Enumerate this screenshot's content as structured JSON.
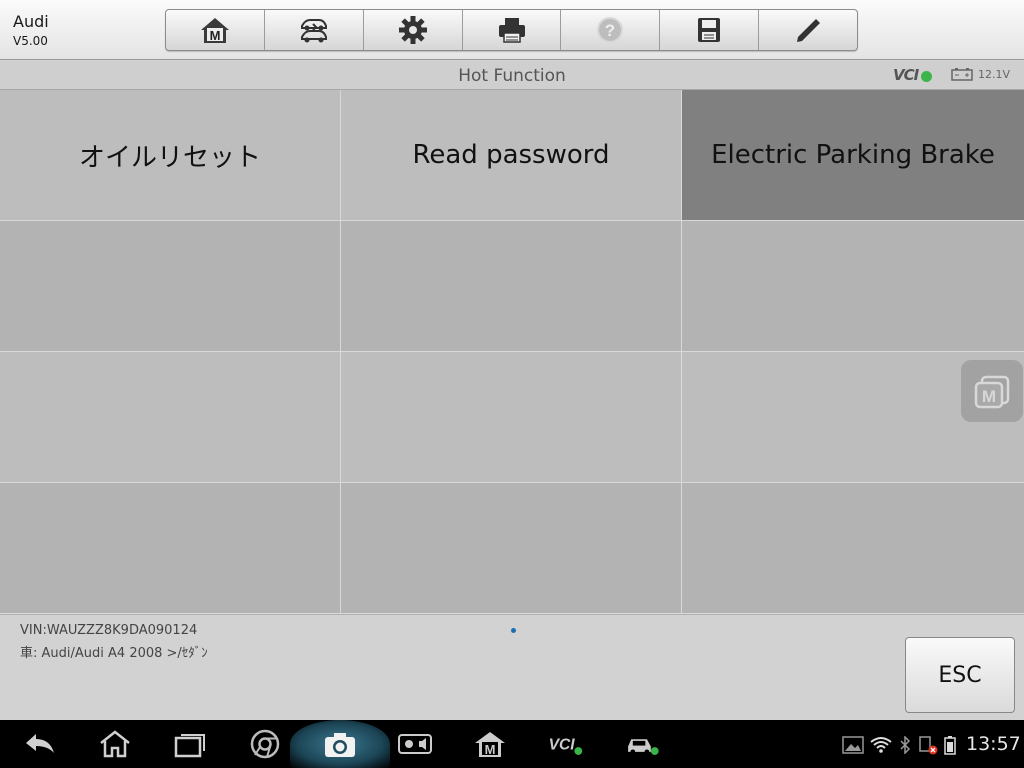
{
  "header": {
    "brand": "Audi",
    "version": "V5.00",
    "toolbar": [
      {
        "name": "home-icon",
        "label": "M"
      },
      {
        "name": "vehicle-swap-icon",
        "label": ""
      },
      {
        "name": "settings-gear-icon",
        "label": ""
      },
      {
        "name": "printer-icon",
        "label": ""
      },
      {
        "name": "help-icon",
        "label": ""
      },
      {
        "name": "save-icon",
        "label": ""
      },
      {
        "name": "edit-pencil-icon",
        "label": ""
      }
    ]
  },
  "subbar": {
    "title": "Hot Function",
    "vci": "VCI",
    "battery_voltage": "12.1V"
  },
  "functions": [
    {
      "label": "オイルリセット",
      "state": "normal"
    },
    {
      "label": "Read password",
      "state": "normal"
    },
    {
      "label": "Electric Parking Brake",
      "state": "selected"
    }
  ],
  "footer": {
    "vin": "VIN:WAUZZZ8K9DA090124",
    "vehicle": "車: Audi/Audi A4 2008 >/ｾﾀﾞﾝ",
    "esc_label": "ESC"
  },
  "navbar": {
    "clock": "13:57",
    "buttons": [
      "back-icon",
      "home-icon",
      "recent-apps-icon",
      "chrome-icon",
      "camera-icon",
      "brightness-volume-icon",
      "maxisys-m-icon",
      "vci-icon",
      "car-icon"
    ]
  },
  "colors": {
    "selected_cell": "#808080",
    "grid_cell": "#b3b3b3",
    "vci_ok": "#3bb54a"
  }
}
